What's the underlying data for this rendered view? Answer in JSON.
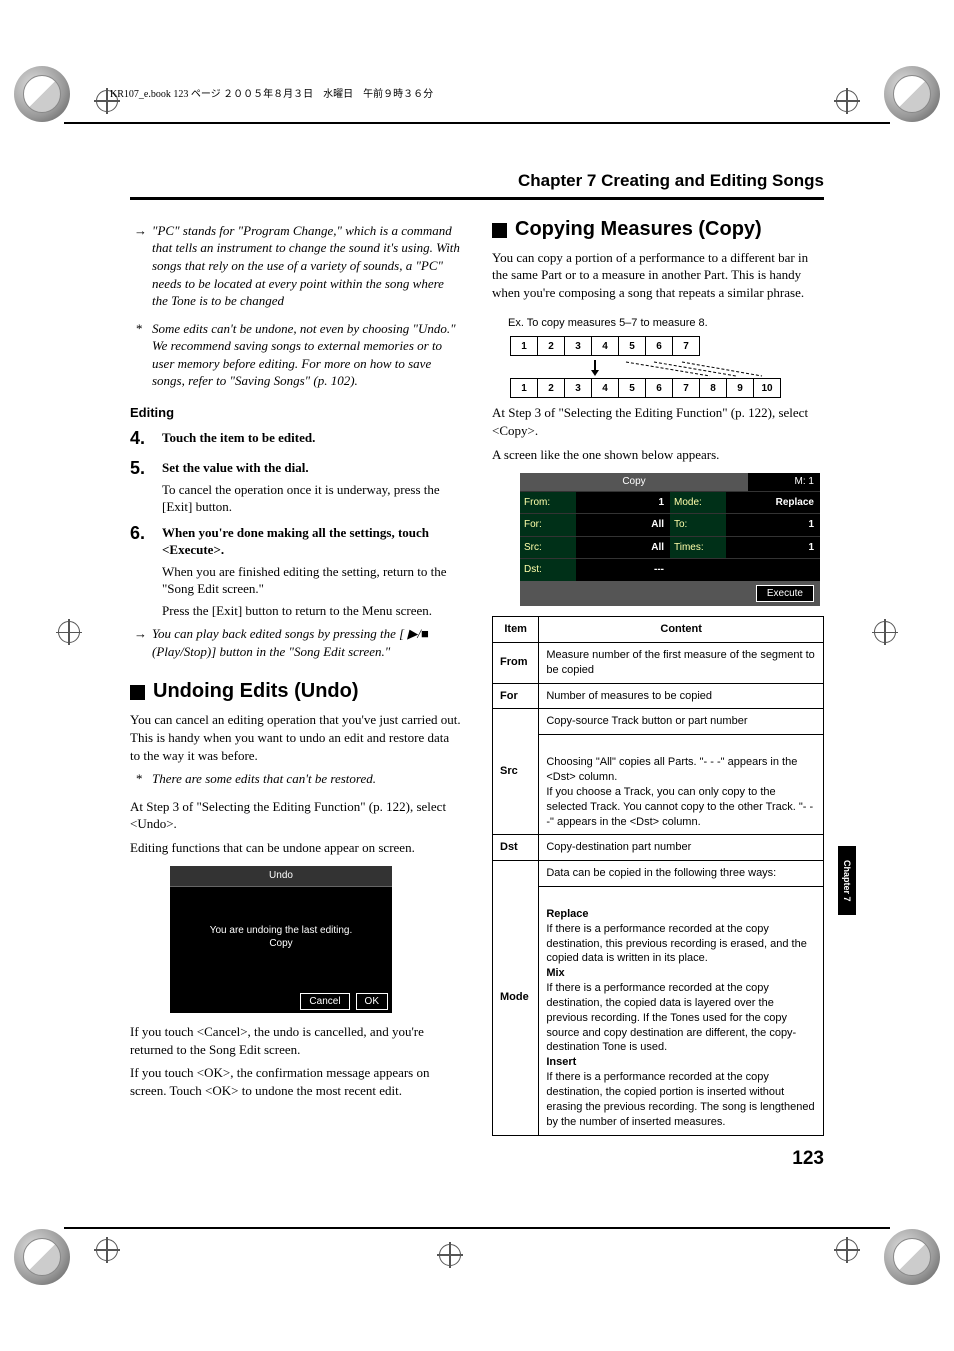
{
  "header_strip": "KR107_e.book  123 ページ  ２００５年８月３日　水曜日　午前９時３６分",
  "chapter_title": "Chapter 7 Creating and Editing Songs",
  "side_tab": "Chapter 7",
  "page_number": "123",
  "left": {
    "note_pc": "\"PC\" stands for \"Program Change,\" which is a command that tells an instrument to change the sound it's using. With songs that rely on the use of a variety of sounds, a \"PC\" needs to be located at every point within the song where the Tone is to be changed",
    "note_undo_save": "Some edits can't be undone, not even by choosing \"Undo.\" We recommend saving songs to external memories or to user memory before editing. For more on how to save songs, refer to \"Saving Songs\" (p. 102).",
    "editing_heading": "Editing",
    "step4": {
      "num": "4.",
      "head": "Touch the item to be edited."
    },
    "step5": {
      "num": "5.",
      "head": "Set the value with the dial.",
      "body": "To cancel the operation once it is underway, press the [Exit] button."
    },
    "step6": {
      "num": "6.",
      "head": "When you're done making all the settings, touch <Execute>.",
      "body1": "When you are finished editing the setting, return to the \"Song Edit screen.\"",
      "body2": "Press the [Exit] button to return to the Menu screen."
    },
    "note_play": "You can play back edited songs by pressing the [ ▶/■  (Play/Stop)] button in the \"Song Edit screen.\"",
    "undo_heading": "Undoing Edits (Undo)",
    "undo_p1": "You can cancel an editing operation that you've just carried out. This is handy when you want to undo an edit and restore data to the way it was before.",
    "undo_star": "There are some edits that can't be restored.",
    "undo_p2": "At Step 3 of \"Selecting the Editing Function\" (p. 122), select <Undo>.",
    "undo_p3": "Editing functions that can be undone appear on screen.",
    "undo_fig": {
      "title": "Undo",
      "msg1": "You are undoing the last editing.",
      "msg2": "Copy",
      "cancel": "Cancel",
      "ok": "OK"
    },
    "undo_p4": "If you touch <Cancel>, the undo is cancelled, and you're returned to the Song Edit screen.",
    "undo_p5": "If you touch <OK>, the confirmation message appears on screen. Touch <OK> to undone the most recent edit."
  },
  "right": {
    "copy_heading": "Copying Measures (Copy)",
    "copy_p1": "You can copy a portion of a performance to a different bar in the same Part or to a measure in another Part. This is handy when you're composing a song that repeats a similar phrase.",
    "ex_caption": "Ex. To copy measures 5–7 to measure 8.",
    "bars_top": [
      "1",
      "2",
      "3",
      "4",
      "5",
      "6",
      "7"
    ],
    "bars_bottom": [
      "1",
      "2",
      "3",
      "4",
      "5",
      "6",
      "7",
      "8",
      "9",
      "10"
    ],
    "copy_p2": "At Step 3 of \"Selecting the Editing Function\" (p. 122), select <Copy>.",
    "copy_p3": "A screen like the one shown below appears.",
    "copy_fig": {
      "title": "Copy",
      "m": "M:   1",
      "rows": [
        {
          "l": "From:",
          "v": "1",
          "l2": "Mode:",
          "v2": "Replace"
        },
        {
          "l": "For:",
          "v": "All",
          "l2": "To:",
          "v2": "1"
        },
        {
          "l": "Src:",
          "v": "All",
          "l2": "Times:",
          "v2": "1"
        },
        {
          "l": "Dst:",
          "v": "---",
          "l2": "",
          "v2": ""
        }
      ],
      "execute": "Execute"
    },
    "table_head": {
      "item": "Item",
      "content": "Content"
    },
    "table": [
      {
        "item": "From",
        "content": "Measure number of the first measure of the segment to be copied"
      },
      {
        "item": "For",
        "content": "Number of measures to be copied"
      },
      {
        "item": "Src",
        "content": "Copy-source Track button or part number\nChoosing \"All\" copies all Parts. \"- - -\" appears in the <Dst> column.\nIf you choose a Track, you can only copy to the selected Track. You cannot copy to the other Track. \"- - -\" appears in the <Dst> column."
      },
      {
        "item": "Dst",
        "content": "Copy-destination part number"
      },
      {
        "item": "Mode",
        "content": "Data can be copied in the following three ways:\nReplace\nIf there is a performance recorded at the copy destination, this previous recording is erased, and the copied data is written in its place.\nMix\nIf there is a performance recorded at the copy destination, the copied data is layered over the previous recording. If the Tones used for the copy source and copy destination are different, the copy-destination Tone is used.\nInsert\nIf there is a performance recorded at the copy destination, the copied portion is inserted without erasing the previous recording. The song is lengthened by the number of inserted measures."
      }
    ]
  }
}
